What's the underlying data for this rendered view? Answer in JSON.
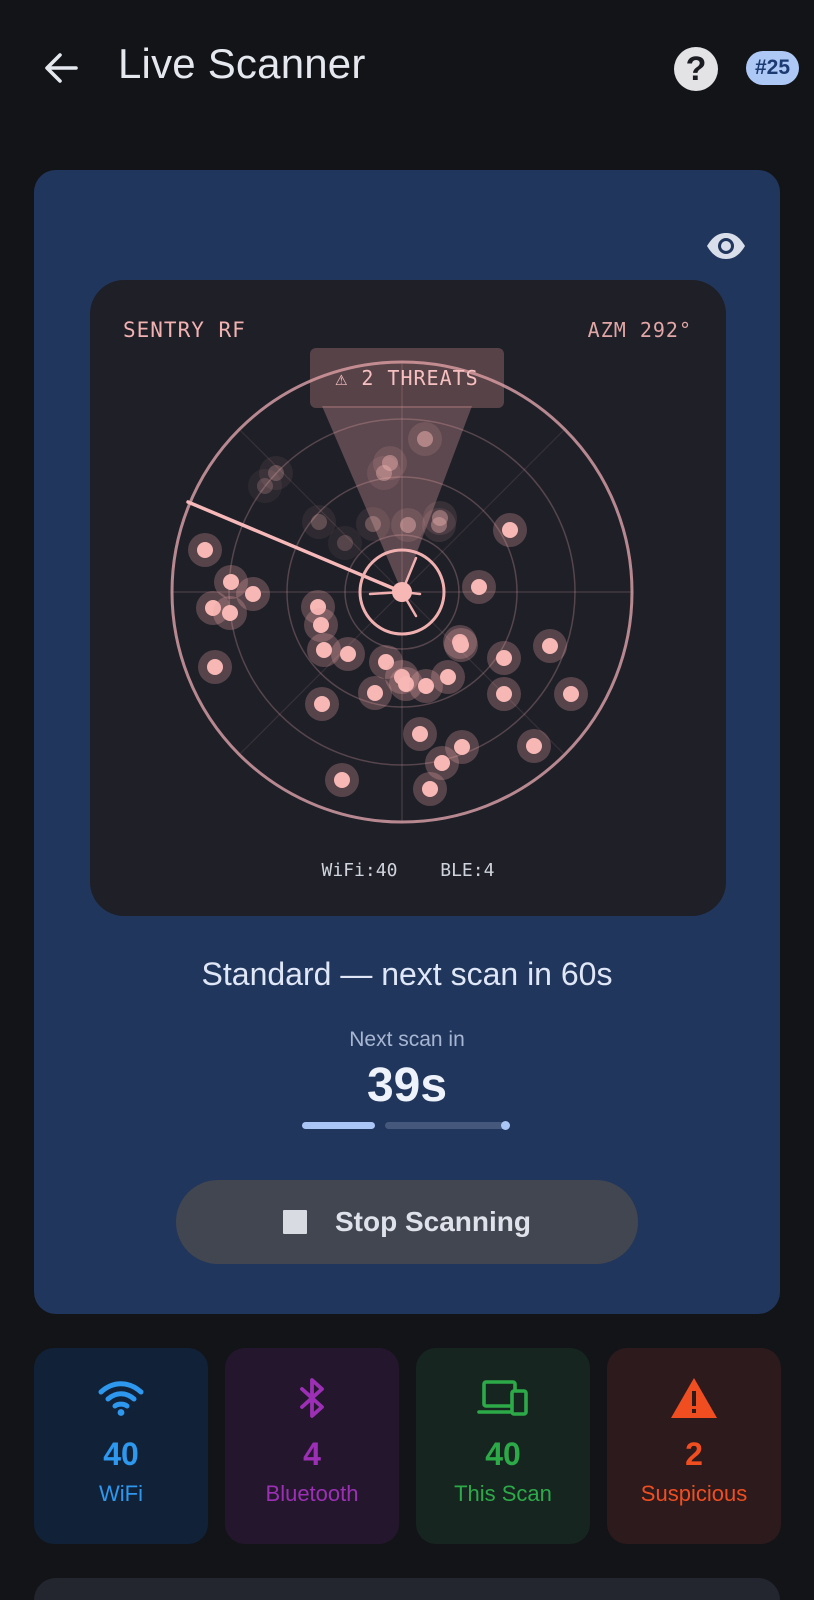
{
  "header": {
    "title": "Live Scanner",
    "back_icon": "arrow-left-icon",
    "help_icon": "help-circle-icon",
    "badge": "#25"
  },
  "scanner_card": {
    "visibility_icon": "eye-icon",
    "radar": {
      "brand": "SENTRY RF",
      "azimuth": "AZM 292°",
      "threat_banner": "⚠ 2 THREATS",
      "wifi_count": "WiFi:40",
      "ble_count": "BLE:4"
    },
    "mode_text": "Standard — next scan in 60s",
    "next_scan_label": "Next scan in",
    "countdown": "39s",
    "progress_fraction": 0.35,
    "stop_button": {
      "label": "Stop Scanning",
      "icon": "stop-square-icon"
    }
  },
  "stats": [
    {
      "icon": "wifi-icon",
      "value": "40",
      "label": "WiFi",
      "color": "#2e97ee"
    },
    {
      "icon": "bluetooth-icon",
      "value": "4",
      "label": "Bluetooth",
      "color": "#9c2fb5"
    },
    {
      "icon": "devices-icon",
      "value": "40",
      "label": "This Scan",
      "color": "#2daa48"
    },
    {
      "icon": "warning-icon",
      "value": "2",
      "label": "Suspicious",
      "color": "#f04e20"
    }
  ],
  "colors": {
    "background": "#121418",
    "card": "#21365c",
    "radar_bg": "#1e1f27",
    "radar_accent": "#f2b2b2",
    "badge_bg": "#aec8f6"
  }
}
